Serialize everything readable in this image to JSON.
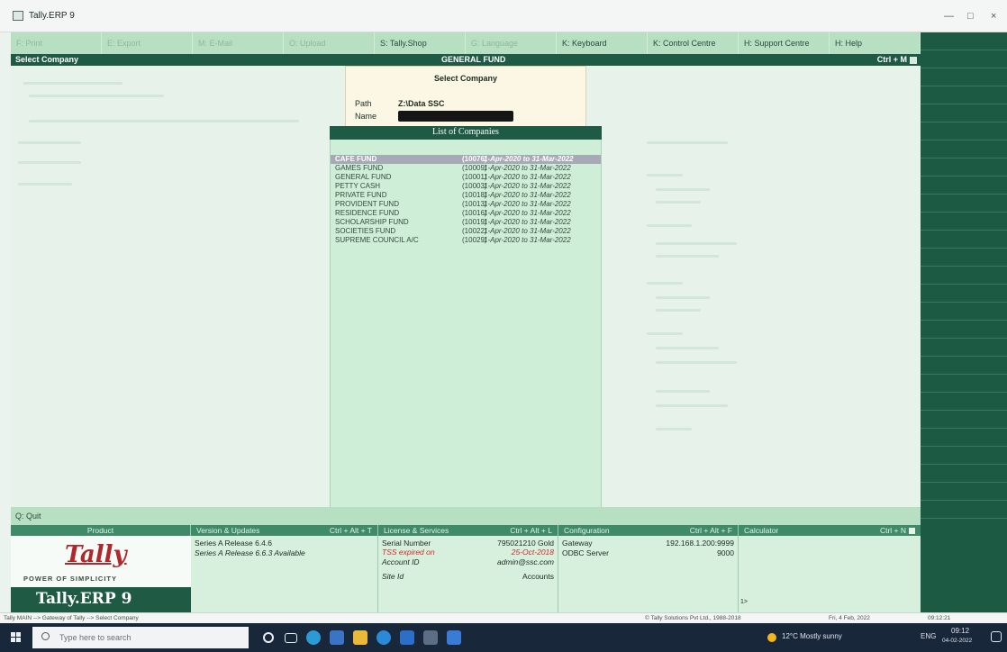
{
  "window": {
    "title": "Tally.ERP 9",
    "close_symbol": "×"
  },
  "topbar": {
    "buttons": [
      {
        "label": "F: Print",
        "enabled": false
      },
      {
        "label": "E: Export",
        "enabled": false
      },
      {
        "label": "M: E-Mail",
        "enabled": false
      },
      {
        "label": "O: Upload",
        "enabled": false
      },
      {
        "label": "S: Tally.Shop",
        "enabled": true
      },
      {
        "label": "G: Language",
        "enabled": false
      },
      {
        "label": "K: Keyboard",
        "enabled": true
      },
      {
        "label": "K: Control Centre",
        "enabled": true
      },
      {
        "label": "H: Support Centre",
        "enabled": true
      },
      {
        "label": "H: Help",
        "enabled": true
      }
    ]
  },
  "header": {
    "left": "Select Company",
    "center": "GENERAL FUND",
    "right": "Ctrl + M"
  },
  "select_company": {
    "title": "Select Company",
    "path_label": "Path",
    "path_value": "Z:\\Data SSC",
    "name_label": "Name"
  },
  "company_list": {
    "title": "List of Companies",
    "rows": [
      {
        "name": "CAFE FUND",
        "id": "(10076)",
        "period": "1-Apr-2020 to 31-Mar-2022",
        "selected": true
      },
      {
        "name": "GAMES FUND",
        "id": "(10009)",
        "period": "1-Apr-2020 to 31-Mar-2022",
        "selected": false
      },
      {
        "name": "GENERAL FUND",
        "id": "(10001)",
        "period": "1-Apr-2020 to 31-Mar-2022",
        "selected": false
      },
      {
        "name": "PETTY CASH",
        "id": "(10003)",
        "period": "1-Apr-2020 to 31-Mar-2022",
        "selected": false
      },
      {
        "name": "PRIVATE FUND",
        "id": "(10018)",
        "period": "1-Apr-2020 to 31-Mar-2022",
        "selected": false
      },
      {
        "name": "PROVIDENT FUND",
        "id": "(10013)",
        "period": "1-Apr-2020 to 31-Mar-2022",
        "selected": false
      },
      {
        "name": "RESIDENCE FUND",
        "id": "(10016)",
        "period": "1-Apr-2020 to 31-Mar-2022",
        "selected": false
      },
      {
        "name": "SCHOLARSHIP FUND",
        "id": "(10019)",
        "period": "1-Apr-2020 to 31-Mar-2022",
        "selected": false
      },
      {
        "name": "SOCIETIES FUND",
        "id": "(10022)",
        "period": "1-Apr-2020 to 31-Mar-2022",
        "selected": false
      },
      {
        "name": "SUPREME COUNCIL A/C",
        "id": "(10029)",
        "period": "1-Apr-2020 to 31-Mar-2022",
        "selected": false
      }
    ]
  },
  "quit": {
    "label": "Q: Quit"
  },
  "bottom": {
    "product": {
      "header": "Product",
      "brand": "Tally",
      "tagline": "POWER OF SIMPLICITY",
      "name": "Tally.ERP 9"
    },
    "version": {
      "header": "Version & Updates",
      "shortcut": "Ctrl + Alt + T",
      "release": "Series A Release 6.4.6",
      "available": "Series A Release 6.6.3 Available"
    },
    "license": {
      "header": "License & Services",
      "shortcut": "Ctrl + Alt + L",
      "serial_label": "Serial Number",
      "serial_value": "795021210 Gold",
      "expired_label": "TSS expired on",
      "expired_value": "25-Oct-2018",
      "account_label": "Account ID",
      "account_value": "admin@ssc.com",
      "site_label": "Site Id",
      "site_value": "Accounts"
    },
    "configuration": {
      "header": "Configuration",
      "shortcut": "Ctrl + Alt + F",
      "gateway_label": "Gateway",
      "gateway_value": "192.168.1.200:9999",
      "odbc_label": "ODBC Server",
      "odbc_value": "9000"
    },
    "calculator": {
      "header": "Calculator",
      "shortcut": "Ctrl + N",
      "prompt": "1>"
    }
  },
  "statusbar": {
    "path": "Tally MAIN --> Gateway of Tally --> Select Company",
    "copyright": "© Tally Solutions Pvt Ltd., 1988-2018",
    "date": "Fri, 4 Feb, 2022",
    "time": "09:12:21"
  },
  "taskbar": {
    "search_placeholder": "Type here to search",
    "weather": "12°C  Mostly sunny",
    "lang": "ENG",
    "clock_time": "09:12",
    "clock_date": "04-02-2022"
  }
}
